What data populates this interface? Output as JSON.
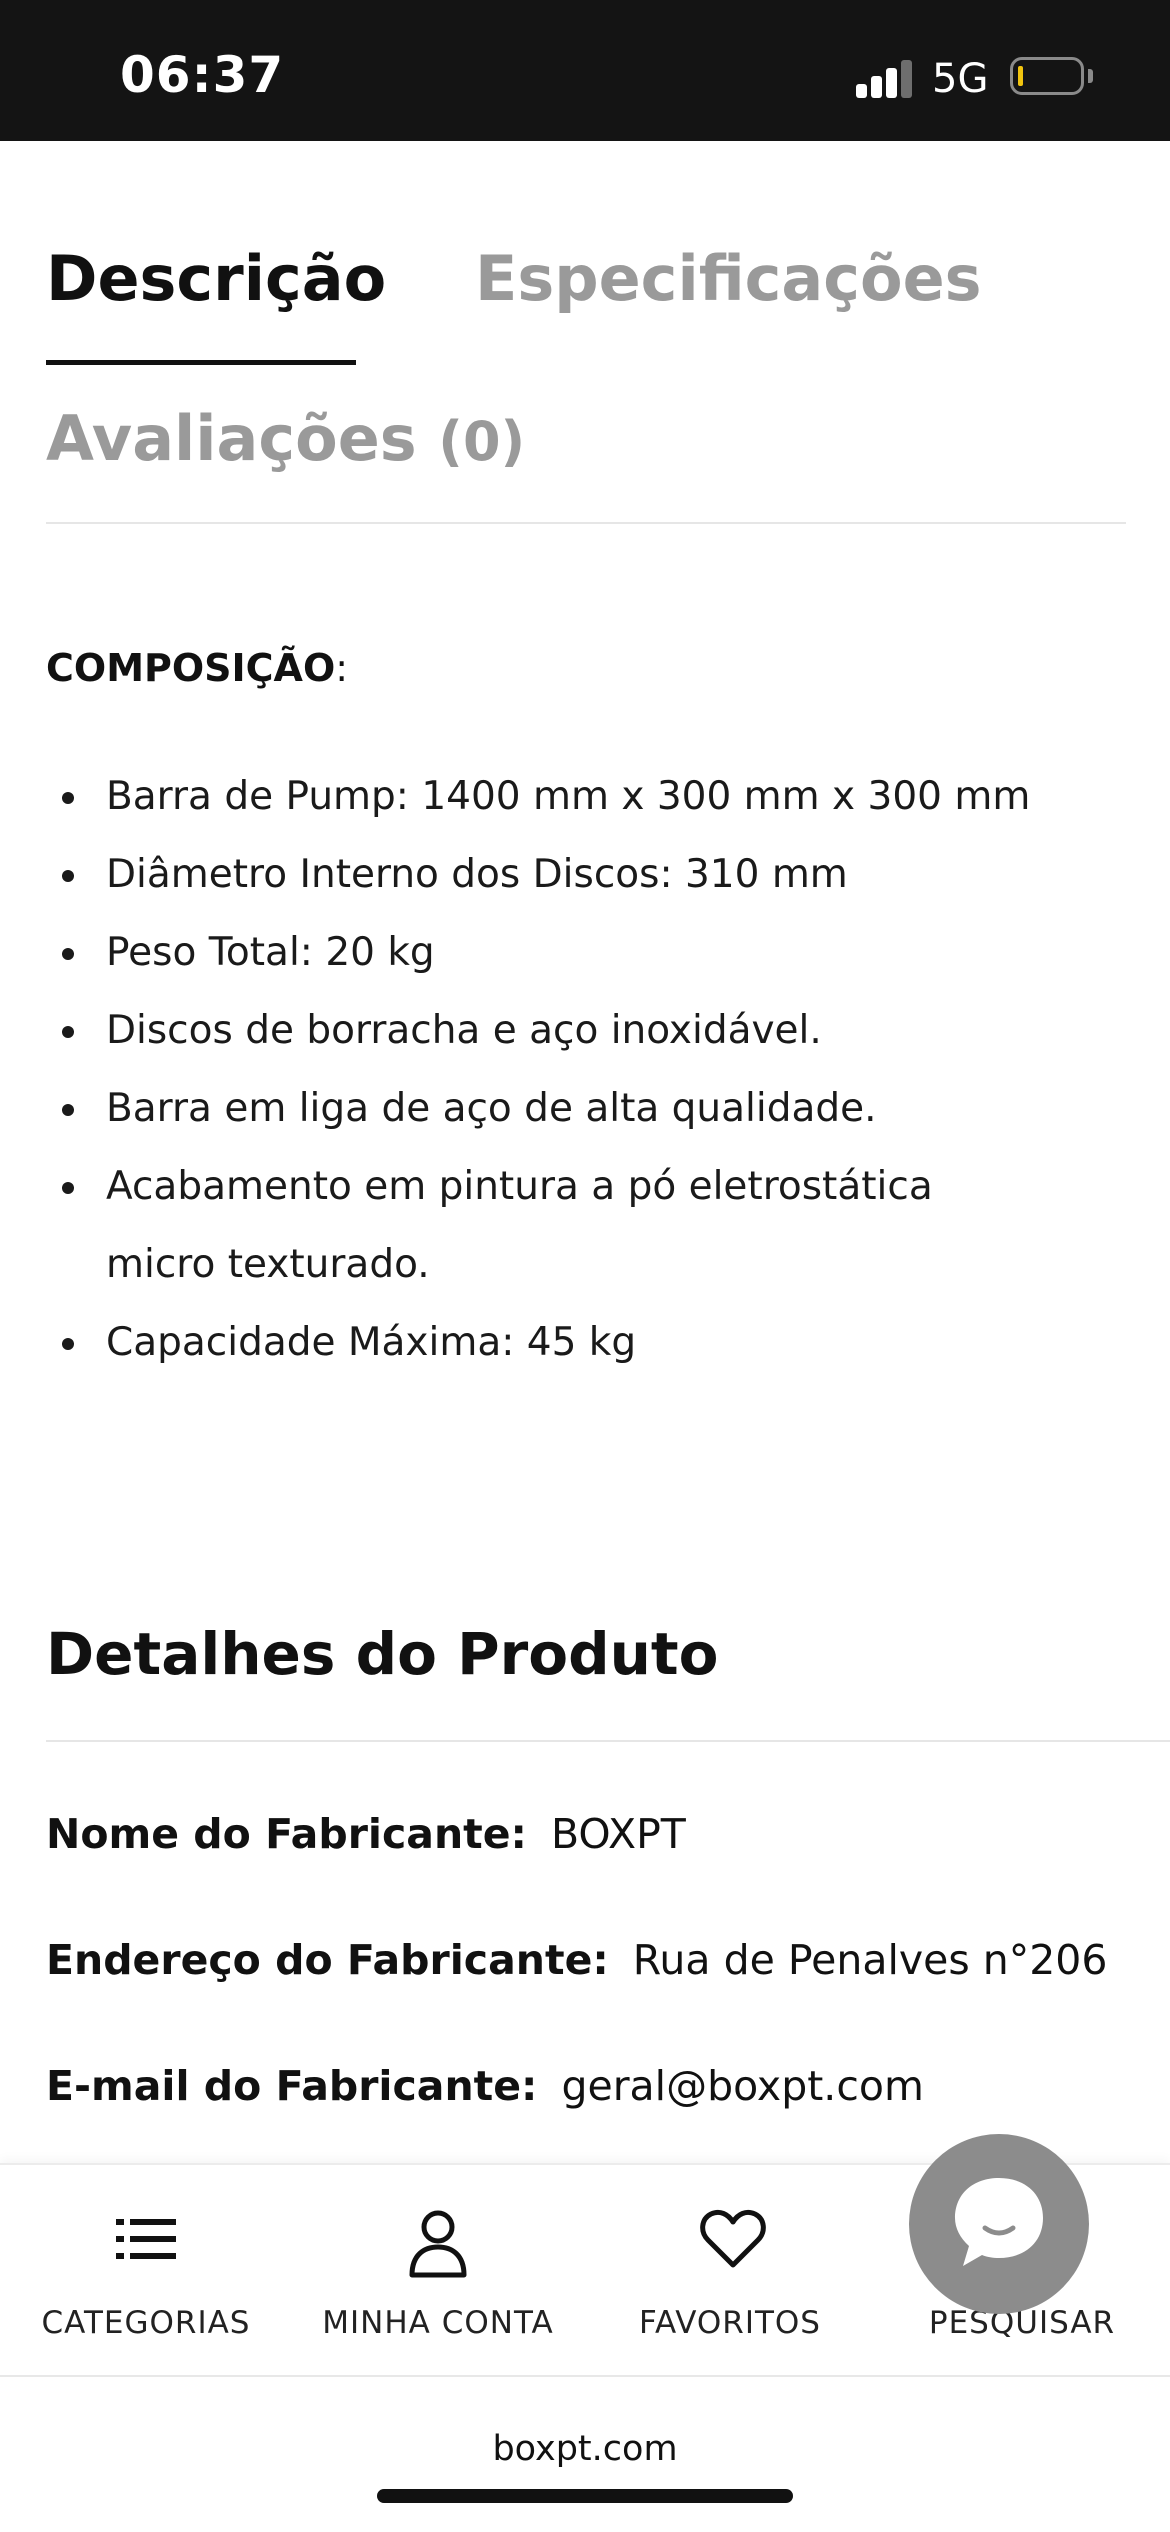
{
  "status_bar": {
    "time": "06:37",
    "network": "5G",
    "icons": [
      "signal-icon",
      "battery-icon"
    ],
    "battery_color": "#f1c40f"
  },
  "tabs": [
    {
      "label": "Descrição",
      "active": true
    },
    {
      "label": "Especificações",
      "active": false
    },
    {
      "label": "Avaliações",
      "count": "(0)",
      "active": false
    }
  ],
  "composition": {
    "heading": "COMPOSIÇÃO",
    "suffix": ":",
    "items": [
      "Barra de Pump: 1400 mm x 300 mm x 300 mm",
      "Diâmetro Interno dos Discos: 310 mm",
      "Peso Total: 20 kg",
      "Discos de borracha e aço inoxidável.",
      "Barra em liga de aço de alta qualidade.",
      "Acabamento em pintura a pó eletrostática micro texturado.",
      "Capacidade Máxima: 45 kg"
    ]
  },
  "details": {
    "title": "Detalhes do Produto",
    "rows": [
      {
        "label": "Nome do Fabricante:",
        "value": "BOXPT"
      },
      {
        "label": "Endereço do Fabricante:",
        "value": "Rua de Penalves n°206"
      },
      {
        "label": "E-mail do Fabricante:",
        "value": "geral@boxpt.com"
      }
    ]
  },
  "bottom_nav": [
    {
      "label": "CATEGORIAS",
      "icon": "list-icon"
    },
    {
      "label": "MINHA CONTA",
      "icon": "user-icon"
    },
    {
      "label": "FAVORITOS",
      "icon": "heart-icon"
    },
    {
      "label": "PESQUISAR",
      "icon": "search-icon"
    }
  ],
  "chat": {
    "icon": "chat-icon",
    "color": "#8c8c8c"
  },
  "browser": {
    "url": "boxpt.com"
  }
}
